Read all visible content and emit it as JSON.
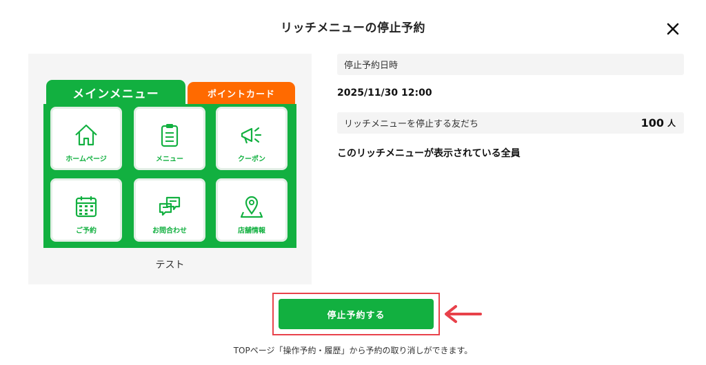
{
  "dialog": {
    "title": "リッチメニューの停止予約",
    "close_icon": "close-icon"
  },
  "preview": {
    "tab_main": "メインメニュー",
    "tab_point": "ポイントカード",
    "colors": {
      "green": "#12b040",
      "orange": "#ff6a00",
      "panel": "#f5f5f5"
    },
    "tiles": [
      {
        "label": "ホームページ",
        "icon": "home-icon"
      },
      {
        "label": "メニュー",
        "icon": "clipboard-icon"
      },
      {
        "label": "クーポン",
        "icon": "megaphone-icon"
      },
      {
        "label": "ご予約",
        "icon": "calendar-icon"
      },
      {
        "label": "お問合わせ",
        "icon": "chat-icon"
      },
      {
        "label": "店舗情報",
        "icon": "map-pin-icon"
      }
    ],
    "name": "テスト"
  },
  "details": {
    "schedule_label": "停止予約日時",
    "schedule_value": "2025/11/30 12:00",
    "friends_label": "リッチメニューを停止する友だち",
    "friends_count": "100",
    "friends_unit": "人",
    "target_note": "このリッチメニューが表示されている全員"
  },
  "actions": {
    "submit_label": "停止予約する",
    "highlight_color": "#e8414a",
    "arrow_icon": "left-arrow-icon"
  },
  "footer_note": "TOPページ「操作予約・履歴」から予約の取り消しができます。"
}
